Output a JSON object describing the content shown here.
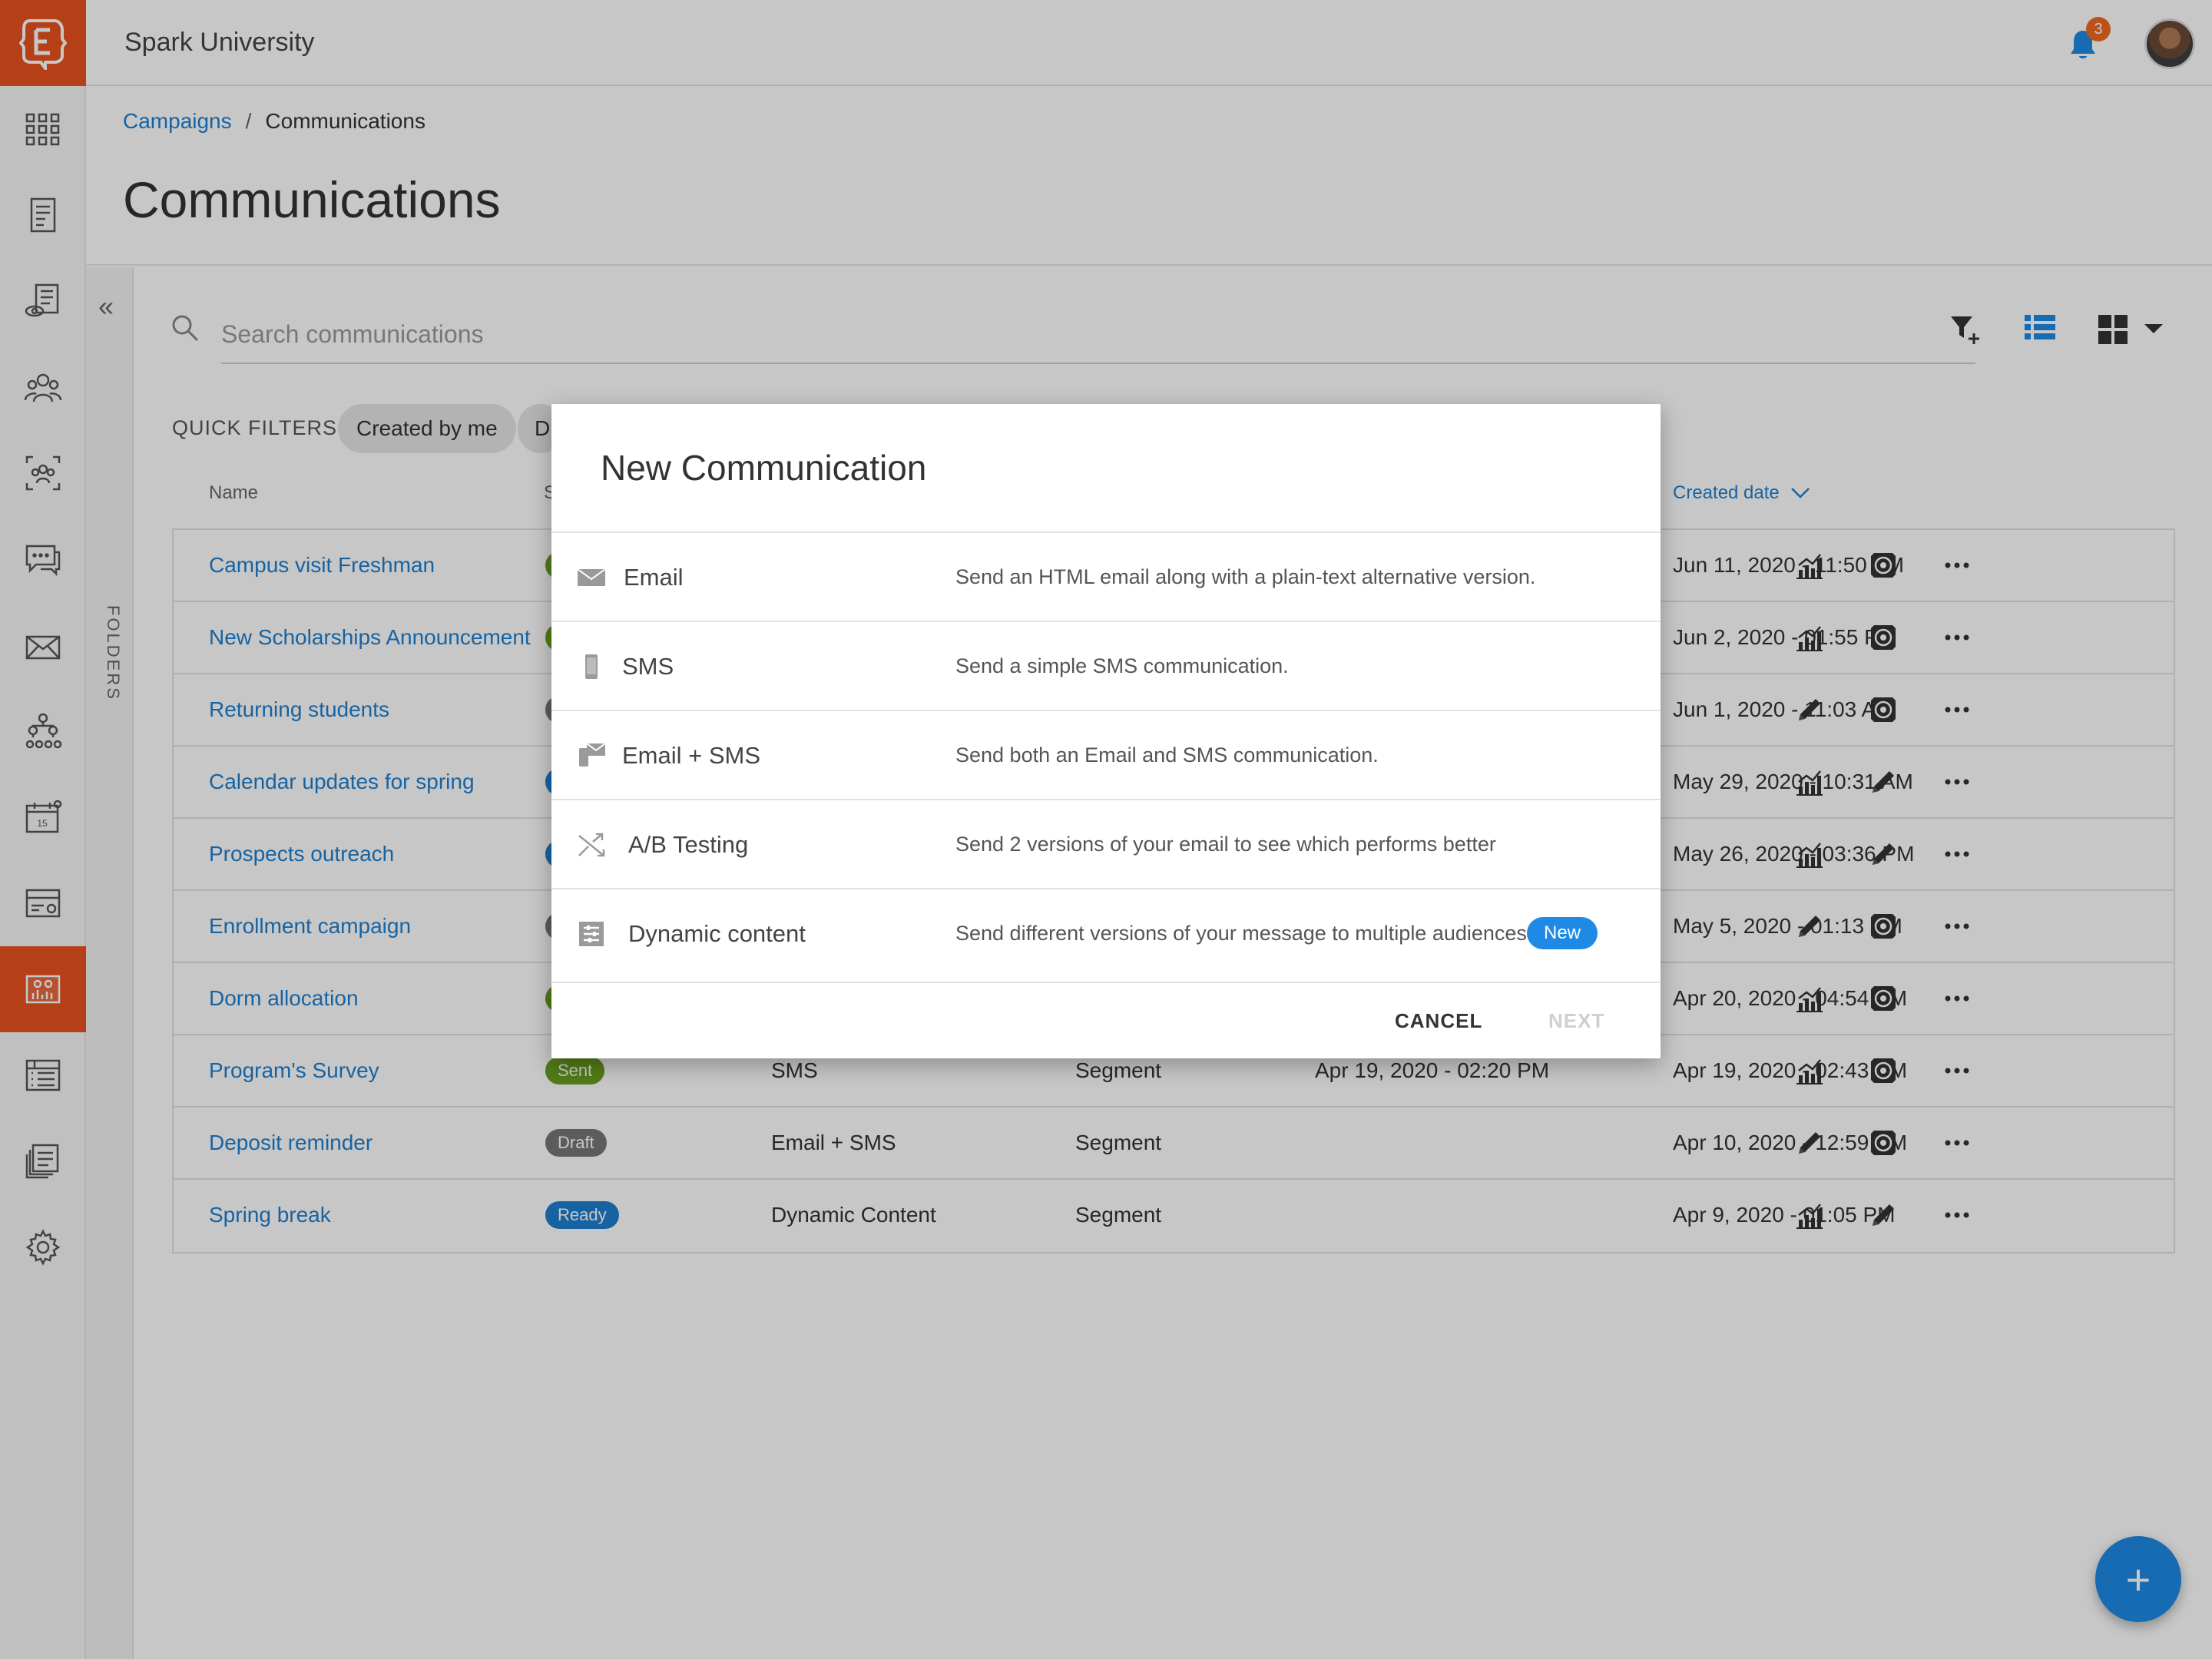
{
  "app": {
    "title": "Spark University",
    "notifications_count": "3"
  },
  "breadcrumb": {
    "parent": "Campaigns",
    "separator": "/",
    "current": "Communications"
  },
  "page": {
    "title": "Communications"
  },
  "folders": {
    "label": "FOLDERS"
  },
  "search": {
    "placeholder": "Search communications"
  },
  "quick_filters": {
    "label": "QUICK FILTERS:",
    "chips": [
      "Created by me",
      "Dr"
    ]
  },
  "table": {
    "headers": {
      "name": "Name",
      "status": "S",
      "created": "Created date"
    },
    "rows": [
      {
        "name": "Campus visit Freshman",
        "status": "",
        "status_color": "#6a9e1f",
        "channel": "",
        "audience": "",
        "sent": "",
        "created": "Jun 11, 2020 - 11:50 AM",
        "actions": [
          "chart-icon",
          "target-icon",
          "more-icon"
        ]
      },
      {
        "name": "New Scholarships Announcement",
        "status": "",
        "status_color": "#6a9e1f",
        "channel": "",
        "audience": "",
        "sent": "",
        "created": "Jun 2, 2020 - 01:55 PM",
        "actions": [
          "chart-icon",
          "target-icon",
          "more-icon"
        ]
      },
      {
        "name": "Returning students",
        "status": "",
        "status_color": "#777777",
        "channel": "",
        "audience": "",
        "sent": "",
        "created": "Jun 1, 2020 - 11:03 AM",
        "actions": [
          "pencil-icon",
          "target-icon",
          "more-icon"
        ]
      },
      {
        "name": "Calendar updates for spring",
        "status": "",
        "status_color": "#1e7fd0",
        "channel": "",
        "audience": "",
        "sent": "",
        "created": "May 29, 2020 - 10:31 AM",
        "actions": [
          "chart-icon",
          "pencil-icon",
          "more-icon"
        ]
      },
      {
        "name": "Prospects outreach",
        "status": "",
        "status_color": "#1e7fd0",
        "channel": "",
        "audience": "",
        "sent": "",
        "created": "May 26, 2020 - 03:36 PM",
        "actions": [
          "chart-icon",
          "pencil-icon",
          "more-icon"
        ]
      },
      {
        "name": "Enrollment campaign",
        "status": "",
        "status_color": "#777777",
        "channel": "",
        "audience": "",
        "sent": "",
        "created": "May 5, 2020 - 01:13 PM",
        "actions": [
          "pencil-icon",
          "target-icon",
          "more-icon"
        ]
      },
      {
        "name": "Dorm allocation",
        "status": "",
        "status_color": "#6a9e1f",
        "channel": "",
        "audience": "",
        "sent": "",
        "created": "Apr 20, 2020 - 04:54 PM",
        "actions": [
          "chart-icon",
          "target-icon",
          "more-icon"
        ]
      },
      {
        "name": "Program's Survey",
        "status": "Sent",
        "status_color": "#6a9e1f",
        "channel": "SMS",
        "audience": "Segment",
        "sent": "Apr 19, 2020 - 02:20 PM",
        "created": "Apr 19, 2020 - 02:43 PM",
        "actions": [
          "chart-icon",
          "target-icon",
          "more-icon"
        ]
      },
      {
        "name": "Deposit reminder",
        "status": "Draft",
        "status_color": "#777777",
        "channel": "Email + SMS",
        "audience": "Segment",
        "sent": "",
        "created": "Apr 10, 2020 - 12:59 PM",
        "actions": [
          "pencil-icon",
          "target-icon",
          "more-icon"
        ]
      },
      {
        "name": "Spring break",
        "status": "Ready",
        "status_color": "#1e7fd0",
        "channel": "Dynamic Content",
        "audience": "Segment",
        "sent": "",
        "created": "Apr 9, 2020 - 01:05 PM",
        "actions": [
          "chart-icon",
          "pencil-icon",
          "more-icon"
        ]
      }
    ]
  },
  "modal": {
    "title": "New Communication",
    "options": [
      {
        "icon": "envelope-icon",
        "label": "Email",
        "description": "Send an HTML email along with a plain-text alternative version.",
        "badge": ""
      },
      {
        "icon": "phone-icon",
        "label": "SMS",
        "description": "Send a simple SMS communication.",
        "badge": ""
      },
      {
        "icon": "email-sms-icon",
        "label": "Email + SMS",
        "description": "Send both an Email and SMS communication.",
        "badge": ""
      },
      {
        "icon": "shuffle-icon",
        "label": "A/B Testing",
        "description": "Send 2 versions of your email to see which performs better",
        "badge": ""
      },
      {
        "icon": "sliders-icon",
        "label": "Dynamic content",
        "description": "Send different versions of your message to multiple audiences",
        "badge": "New"
      }
    ],
    "cancel_label": "CANCEL",
    "next_label": "NEXT"
  },
  "fab": {
    "label": "+"
  },
  "colors": {
    "brand": "#e8531f",
    "accent": "#1e8ae6",
    "link": "#1e7fd0"
  },
  "sidebar": {
    "items": [
      "dashboard-grid-icon",
      "forms-icon",
      "views-icon",
      "people-icon",
      "groups-icon",
      "chat-icon",
      "email-icon",
      "org-chart-icon",
      "calendar-icon",
      "cards-icon",
      "campaigns-icon",
      "table-icon",
      "documents-icon",
      "settings-gear-icon"
    ],
    "active_item": "campaigns-icon"
  }
}
